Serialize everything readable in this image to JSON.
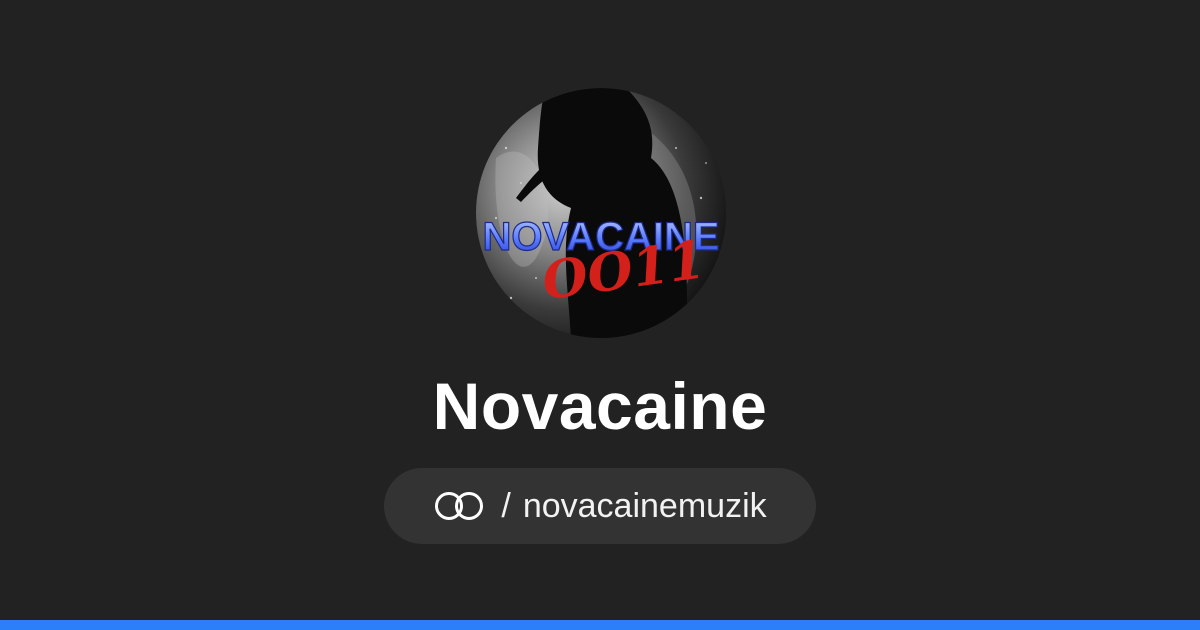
{
  "profile": {
    "display_name": "Novacaine",
    "separator": "/",
    "username": "novacainemuzik",
    "avatar_logo_text": "NOVACAINE",
    "avatar_script_text": "OO11"
  },
  "icons": {
    "platform_logo": "linked-rings-icon"
  },
  "colors": {
    "background": "#222222",
    "pill_background": "#333333",
    "accent_bar": "#2d7ff9",
    "text": "#ffffff"
  }
}
